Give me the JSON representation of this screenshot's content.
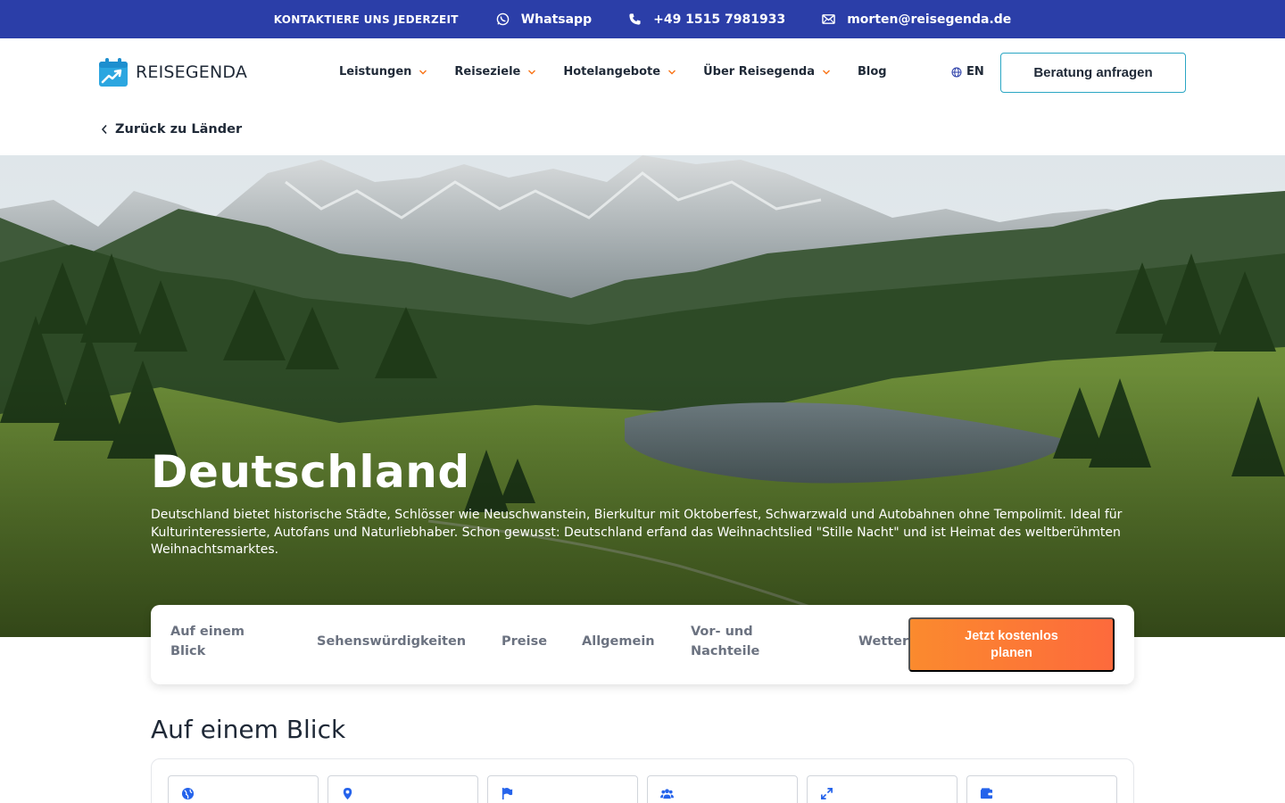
{
  "topbar": {
    "contact_title": "KONTAKTIERE UNS JEDERZEIT",
    "whatsapp": "Whatsapp",
    "phone": "+49 1515 7981933",
    "email": "morten@reisegenda.de",
    "background_color": "#2b3ea8"
  },
  "header": {
    "logo_text": "REISEGENDA",
    "nav": {
      "leistungen": "Leistungen",
      "reiseziele": "Reiseziele",
      "hotelangebote": "Hotelangebote",
      "ueber": "Über Reisegenda",
      "blog": "Blog"
    },
    "language": "EN",
    "consult_button": "Beratung anfragen",
    "accent_color": "#2ba6c4",
    "chevron_color": "#f97316"
  },
  "back_link": "Zurück zu Länder",
  "hero": {
    "title": "Deutschland",
    "description": "Deutschland bietet historische Städte, Schlösser wie Neuschwanstein, Bierkultur mit Oktoberfest, Schwarzwald und Autobahnen ohne Tempolimit. Ideal für Kulturinteressierte, Autofans und Naturliebhaber. Schon gewusst: Deutschland erfand das Weihnachtslied \"Stille Nacht\" und ist Heimat des weltberühmten Weihnachtsmarktes."
  },
  "tabs": {
    "auf_einem_blick": "Auf einem Blick",
    "sehenswuerdigkeiten": "Sehenswürdigkeiten",
    "preise": "Preise",
    "allgemein": "Allgemein",
    "vor_nachteile": "Vor- und Nachteile",
    "wetter": "Wetter",
    "cta": "Jetzt kostenlos planen",
    "cta_color": "#fb7a34"
  },
  "section": {
    "title": "Auf einem Blick",
    "fact_icons": [
      "globe-icon",
      "map-pin-icon",
      "flag-icon",
      "people-icon",
      "expand-icon",
      "wallet-icon"
    ],
    "icon_color": "#2563eb"
  }
}
